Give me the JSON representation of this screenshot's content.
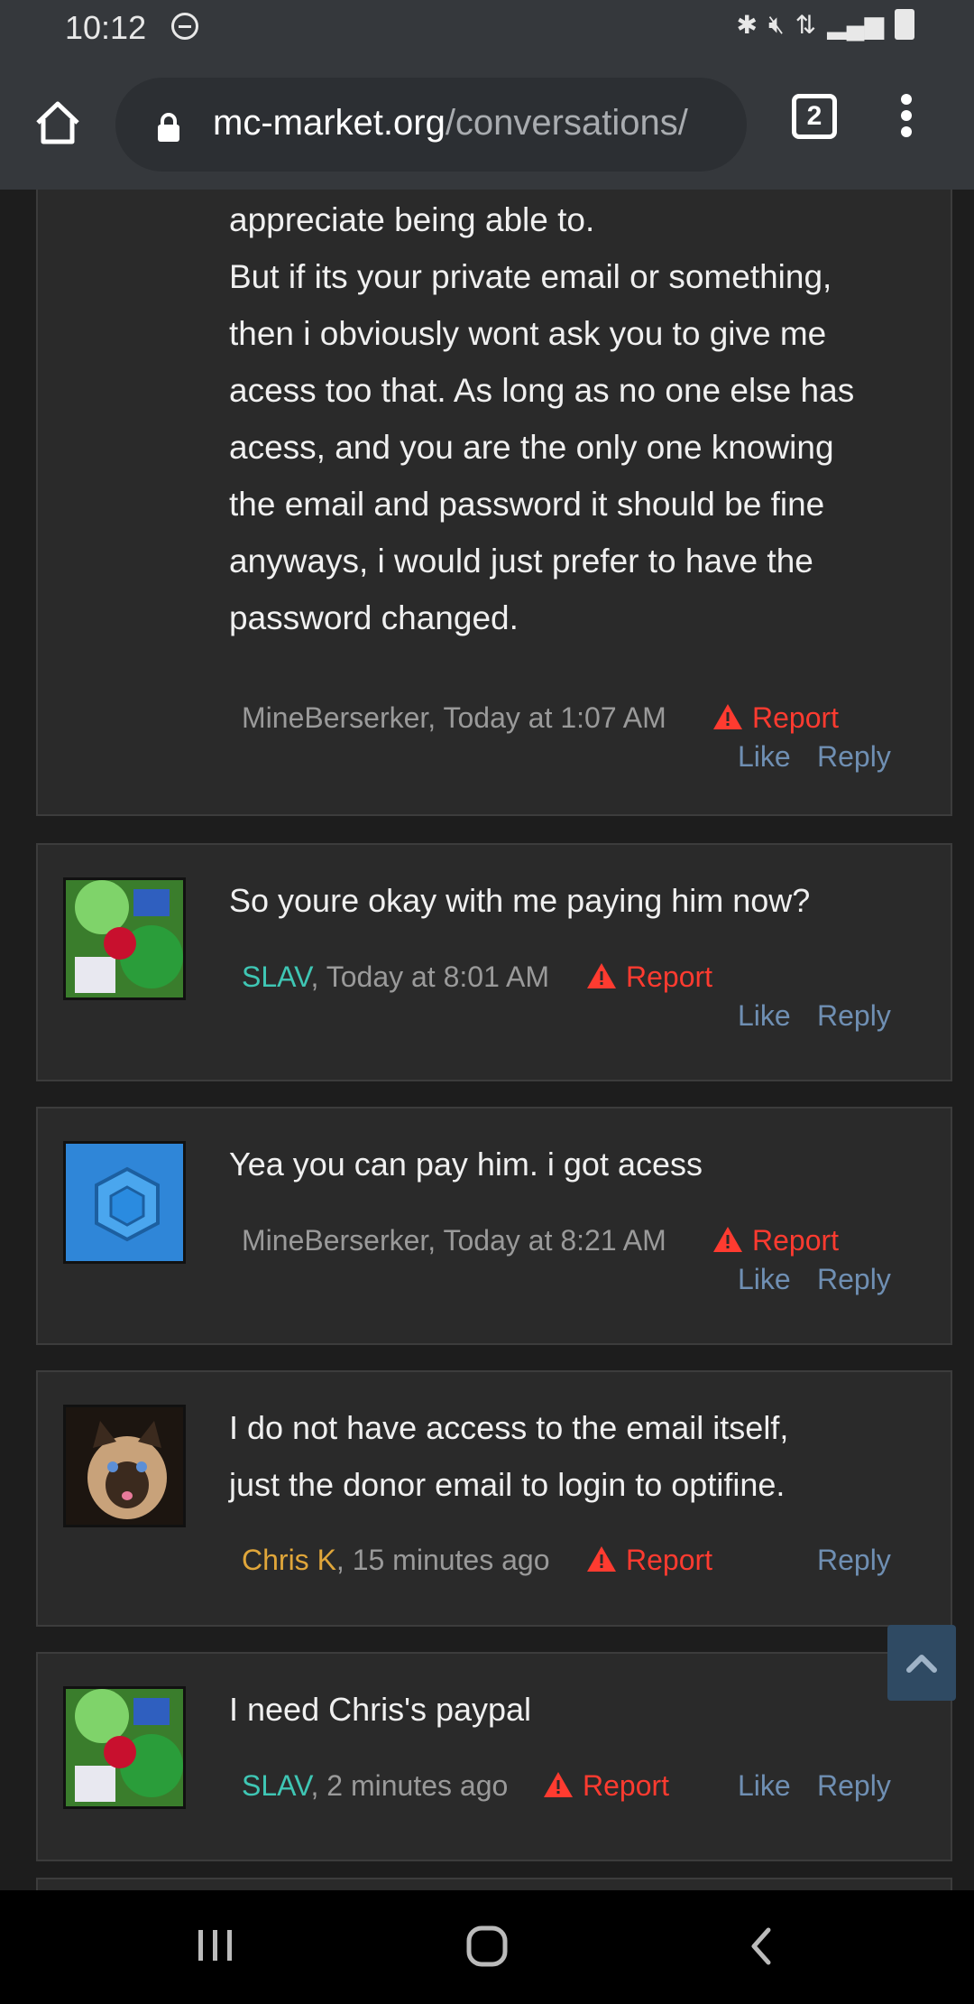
{
  "status": {
    "time": "10:12"
  },
  "browser": {
    "url_domain": "mc-market.org",
    "url_path": "/conversations/",
    "tab_count": "2"
  },
  "messages": [
    {
      "lines": [
        "appreciate being able to.",
        "But if its your private email or something,",
        "then i obviously wont ask you to give me",
        "acess too that. As long as no one else has",
        "acess, and you are the only one knowing",
        "the email and password it should be fine",
        "anyways, i would just prefer to have the",
        "password changed."
      ],
      "author": "MineBerserker",
      "time": ", Today at 1:07 AM",
      "report": "Report",
      "like": "Like",
      "reply": "Reply"
    },
    {
      "lines": [
        "So youre okay with me paying him now?"
      ],
      "author": "SLAV",
      "time": ", Today at 8:01 AM",
      "report": "Report",
      "like": "Like",
      "reply": "Reply"
    },
    {
      "lines": [
        "Yea you can pay him. i got acess"
      ],
      "author": "MineBerserker",
      "time": ", Today at 8:21 AM",
      "report": "Report",
      "like": "Like",
      "reply": "Reply"
    },
    {
      "lines": [
        "I do not have access to the email itself,",
        "just the donor email to login to optifine."
      ],
      "author": "Chris K",
      "time": ", 15 minutes ago",
      "report": "Report",
      "reply": "Reply"
    },
    {
      "lines": [
        "I need Chris's paypal"
      ],
      "author": "SLAV",
      "time": ", 2 minutes ago",
      "report": "Report",
      "like": "Like",
      "reply": "Reply"
    }
  ]
}
